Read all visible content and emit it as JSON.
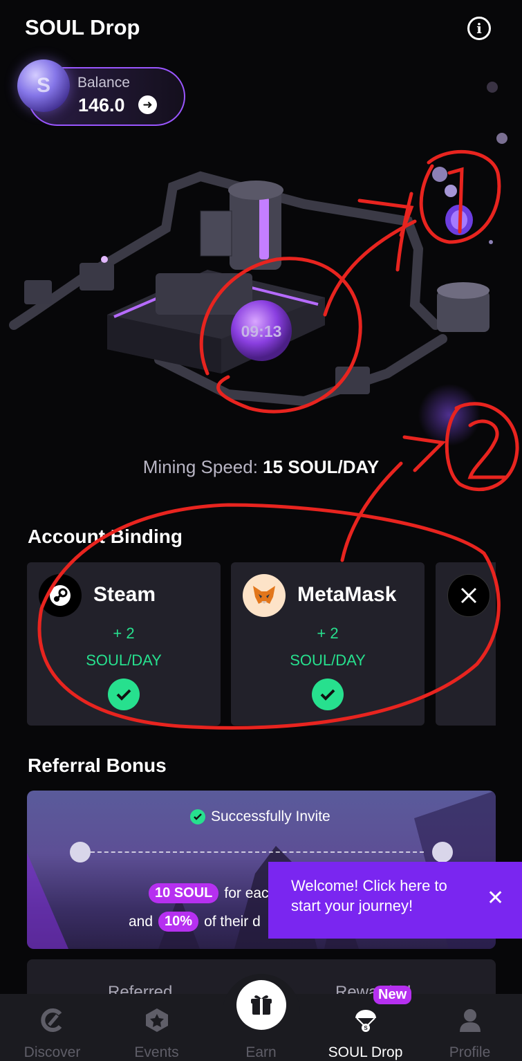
{
  "header": {
    "title": "SOUL Drop",
    "info_icon": "info-icon"
  },
  "balance": {
    "label": "Balance",
    "value": "146.0",
    "coin_icon": "soul-coin-icon",
    "arrow_icon": "arrow-right-icon"
  },
  "mining": {
    "timer": "09:13",
    "speed_label": "Mining Speed:",
    "speed_value": "15 SOUL/DAY"
  },
  "account_binding": {
    "title": "Account Binding",
    "cards": [
      {
        "name": "Steam",
        "bonus": "+ 2",
        "unit": "SOUL/DAY",
        "icon": "steam-icon",
        "bound": true
      },
      {
        "name": "MetaMask",
        "bonus": "+ 2",
        "unit": "SOUL/DAY",
        "icon": "metamask-fox-icon",
        "bound": true
      },
      {
        "name": "X",
        "icon": "x-icon"
      }
    ]
  },
  "referral": {
    "title": "Referral Bonus",
    "invite_text": "Successfully Invite",
    "reward_amount": "10 SOUL",
    "reward_text": "for eac",
    "and_text": "and",
    "percent": "10%",
    "percent_text": "of their d"
  },
  "tooltip": {
    "text": "Welcome! Click here to start your journey!",
    "close_icon": "close-icon"
  },
  "stats": {
    "referred_label": "Referred",
    "rewarded_label": "Rewarded"
  },
  "annotations": {
    "mark_1": "①",
    "mark_2": "②"
  },
  "tabbar": {
    "new_badge": "New",
    "tabs": [
      {
        "label": "Discover",
        "icon": "discover-icon",
        "active": false
      },
      {
        "label": "Events",
        "icon": "events-icon",
        "active": false
      },
      {
        "label": "Earn",
        "icon": "gift-icon",
        "active": false
      },
      {
        "label": "SOUL Drop",
        "icon": "parachute-icon",
        "active": true
      },
      {
        "label": "Profile",
        "icon": "profile-icon",
        "active": false
      }
    ]
  },
  "colors": {
    "accent_purple": "#7a26f0",
    "success_green": "#27e08e",
    "badge_magenta": "#b630f0",
    "annotation_red": "#e8241f"
  }
}
